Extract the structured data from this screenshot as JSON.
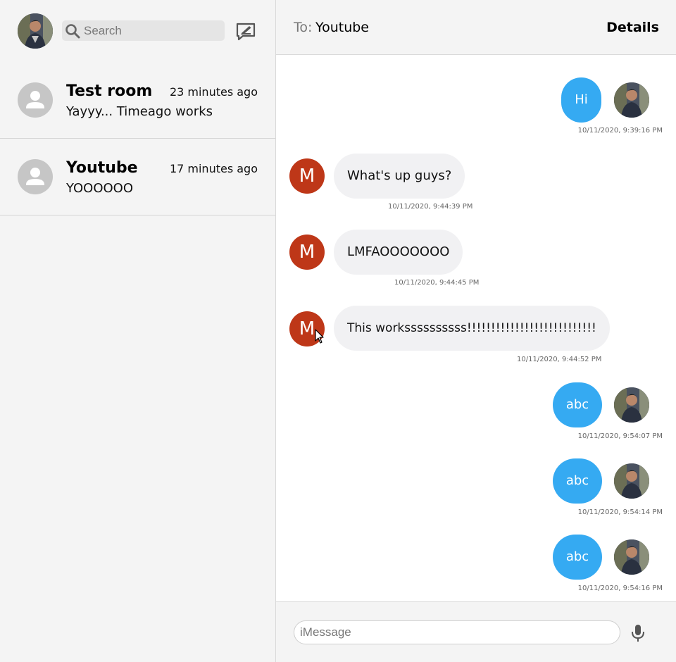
{
  "sidebar": {
    "search": {
      "placeholder": "Search"
    },
    "icons": {
      "search": "search-icon",
      "compose": "compose-icon",
      "user": "user-avatar-icon"
    },
    "rooms": [
      {
        "name": "Test room",
        "time": "23 minutes ago",
        "last_message": "Yayyy... Timeago works"
      },
      {
        "name": "Youtube",
        "time": "17 minutes ago",
        "last_message": "YOOOOOO"
      }
    ]
  },
  "chat": {
    "header": {
      "to_label": "To:",
      "to_name": "Youtube",
      "details_label": "Details"
    },
    "messages": [
      {
        "from": "me",
        "text": "Hi",
        "timestamp": "10/11/2020, 9:39:16 PM"
      },
      {
        "from": "other",
        "initial": "M",
        "text": "What's up guys?",
        "timestamp": "10/11/2020, 9:44:39 PM"
      },
      {
        "from": "other",
        "initial": "M",
        "text": "LMFAOOOOOOO",
        "timestamp": "10/11/2020, 9:44:45 PM"
      },
      {
        "from": "other",
        "initial": "M",
        "text": "This workssssssssss!!!!!!!!!!!!!!!!!!!!!!!!!!!",
        "timestamp": "10/11/2020, 9:44:52 PM"
      },
      {
        "from": "me",
        "text": "abc",
        "timestamp": "10/11/2020, 9:54:07 PM"
      },
      {
        "from": "me",
        "text": "abc",
        "timestamp": "10/11/2020, 9:54:14 PM"
      },
      {
        "from": "me",
        "text": "abc",
        "timestamp": "10/11/2020, 9:54:16 PM"
      }
    ],
    "composer": {
      "placeholder": "iMessage",
      "mic_icon": "microphone-icon"
    }
  },
  "colors": {
    "outgoing_bubble": "#35aaf2",
    "incoming_bubble": "#f1f1f3",
    "other_avatar": "#be3718",
    "panel_bg": "#f4f4f4"
  }
}
